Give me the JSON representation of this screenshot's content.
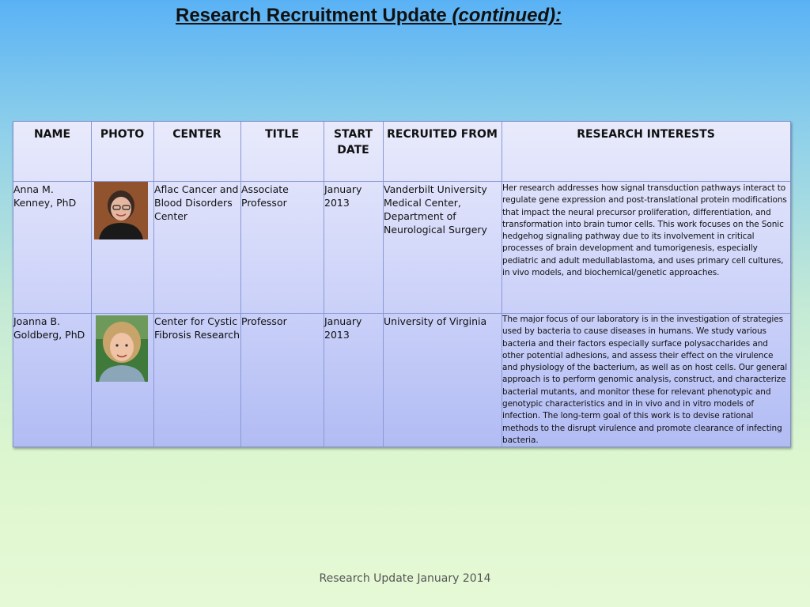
{
  "title": {
    "main": "Research Recruitment Update ",
    "cont": "(continued):"
  },
  "headers": {
    "name": "NAME",
    "photo": "PHOTO",
    "center": "CENTER",
    "title": "TITLE",
    "start_date_1": "START",
    "start_date_2": "DATE",
    "recruited_from": "RECRUITED FROM",
    "research_interests": "RESEARCH INTERESTS"
  },
  "rows": [
    {
      "name_1": "Anna M.",
      "name_2": "Kenney, PhD",
      "center": [
        "Aflac Cancer and",
        "Blood Disorders",
        "Center"
      ],
      "title": [
        "Associate",
        "Professor"
      ],
      "start": [
        "January",
        "2013"
      ],
      "recruited_from": [
        "Vanderbilt University",
        "Medical Center,",
        "Department of",
        "Neurological Surgery"
      ],
      "research": [
        "Her research addresses how signal transduction pathways interact to",
        "regulate gene expression and post-translational protein modifications",
        "that impact the neural precursor proliferation, differentiation, and",
        "transformation into brain tumor cells.  This work focuses on the Sonic",
        "hedgehog signaling pathway due to its involvement in critical",
        "processes of brain development and tumorigenesis, especially",
        "pediatric and adult medullablastoma, and uses primary cell cultures,",
        "in vivo models, and biochemical/genetic approaches."
      ]
    },
    {
      "name_1": "Joanna B.",
      "name_2": "Goldberg, PhD",
      "center": [
        "Center for Cystic",
        "Fibrosis Research"
      ],
      "title": [
        "Professor"
      ],
      "start": [
        "January",
        "2013"
      ],
      "recruited_from": [
        "University of Virginia"
      ],
      "research": [
        "The major focus of our laboratory is in the investigation of strategies",
        "used by bacteria to cause diseases in humans. We study various",
        "bacteria and their factors especially surface polysaccharides and",
        "other potential adhesions, and assess their effect on the virulence",
        "and physiology of the bacterium, as well as on host cells. Our general",
        "approach is to perform genomic analysis, construct, and characterize",
        "bacterial mutants, and monitor these for relevant phenotypic and",
        "genotypic characteristics and in in vivo and in vitro models of",
        "infection. The long-term goal of this work is to devise rational",
        "methods to the disrupt virulence and promote clearance of infecting",
        "bacteria."
      ]
    }
  ],
  "footer": "Research Update January 2014"
}
